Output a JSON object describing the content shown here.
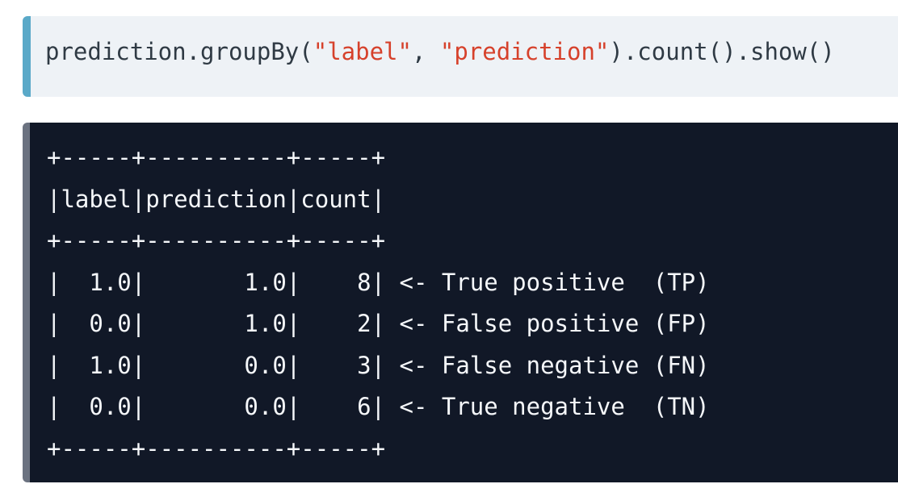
{
  "code_cell": {
    "prefix": "prediction.groupBy(",
    "arg1": "\"label\"",
    "separator": ", ",
    "arg2": "\"prediction\"",
    "suffix": ").count().show()"
  },
  "output": {
    "lines": [
      "+-----+----------+-----+",
      "|label|prediction|count|",
      "+-----+----------+-----+",
      "|  1.0|       1.0|    8| <- True positive  (TP)",
      "|  0.0|       1.0|    2| <- False positive (FP)",
      "|  1.0|       0.0|    3| <- False negative (FN)",
      "|  0.0|       0.0|    6| <- True negative  (TN)",
      "+-----+----------+-----+"
    ]
  }
}
